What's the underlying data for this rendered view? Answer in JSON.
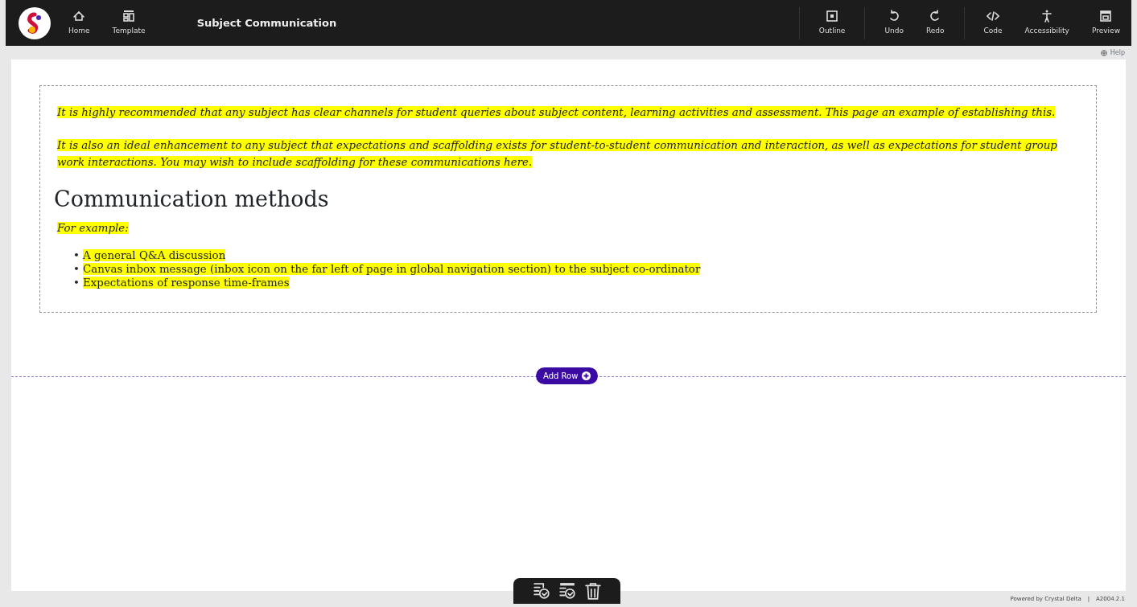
{
  "toolbar": {
    "left_items": [
      {
        "label": "Home",
        "kind": "home"
      },
      {
        "label": "Template",
        "kind": "template"
      }
    ],
    "title": "Subject Communication",
    "right_groups": [
      [
        {
          "label": "Outline",
          "kind": "outline"
        }
      ],
      [
        {
          "label": "Undo",
          "kind": "undo"
        },
        {
          "label": "Redo",
          "kind": "redo"
        }
      ],
      [
        {
          "label": "Code",
          "kind": "code"
        },
        {
          "label": "Accessibility",
          "kind": "accessibility"
        },
        {
          "label": "Preview",
          "kind": "preview"
        }
      ]
    ]
  },
  "help": "Help",
  "content": {
    "paragraphs": [
      "It is highly recommended that any subject has clear channels for student queries about subject content, learning activities and assessment. This page an example of establishing this.",
      "It is also an ideal enhancement to any subject that expectations and scaffolding exists for student-to-student communication and interaction, as well as expectations for student group work interactions. You may wish to include scaffolding for these communications here."
    ],
    "heading": "Communication methods",
    "intro": "For example:",
    "list": [
      {
        "marker": "•",
        "text": "A general Q&A discussion"
      },
      {
        "marker": "•",
        "text": "Canvas inbox message (inbox icon on the far left of page in global navigation section) to the subject co-ordinator"
      },
      {
        "marker": "•",
        "text": "Expectations of response time-frames"
      }
    ]
  },
  "add_row": "Add Row",
  "bottom_tools": [
    {
      "kind": "check-list"
    },
    {
      "kind": "check-layout"
    },
    {
      "kind": "trash"
    }
  ],
  "footer": {
    "powered": "Powered by Crystal Delta",
    "separator": "|",
    "version": "A2004.2.1"
  }
}
